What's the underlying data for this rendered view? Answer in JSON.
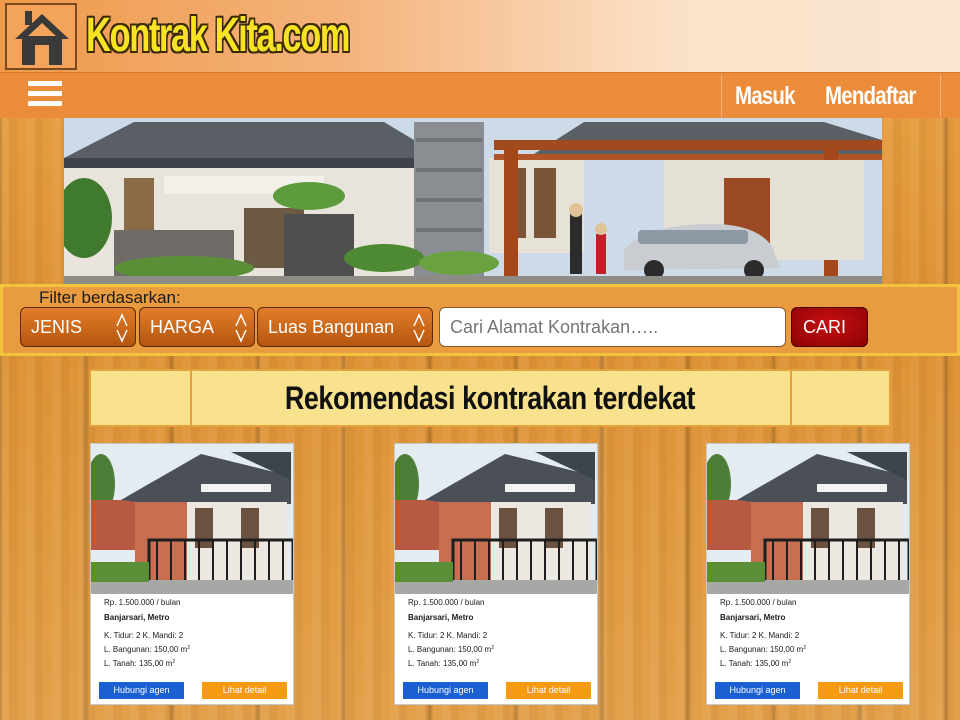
{
  "header": {
    "site_name": "Kontrak Kita.com"
  },
  "nav": {
    "login": "Masuk",
    "register": "Mendaftar"
  },
  "filter": {
    "title": "Filter berdasarkan:",
    "selects": [
      {
        "label": "JENIS"
      },
      {
        "label": "HARGA"
      },
      {
        "label": "Luas Bangunan"
      }
    ],
    "search_placeholder": "Cari Alamat Kontrakan…..",
    "search_button": "CARI"
  },
  "section": {
    "title": "Rekomendasi kontrakan terdekat"
  },
  "cards": [
    {
      "price": "Rp. 1.500.000  /  bulan",
      "location": "Banjarsari, Metro",
      "rooms": "K. Tidur: 2   K. Mandi: 2",
      "bangunan": "L. Bangunan: 150,00 m",
      "tanah": "L. Tanah: 135,00 m",
      "unit_sup": "2",
      "contact_button": "Hubungi agen",
      "detail_button": "Lihat detail"
    },
    {
      "price": "Rp. 1.500.000  /  bulan",
      "location": "Banjarsari, Metro",
      "rooms": "K. Tidur: 2   K. Mandi: 2",
      "bangunan": "L. Bangunan: 150,00 m",
      "tanah": "L. Tanah: 135,00 m",
      "unit_sup": "2",
      "contact_button": "Hubungi agen",
      "detail_button": "Lihat detail"
    },
    {
      "price": "Rp. 1.500.000  /  bulan",
      "location": "Banjarsari, Metro",
      "rooms": "K. Tidur: 2   K. Mandi: 2",
      "bangunan": "L. Bangunan: 150,00 m",
      "tanah": "L. Tanah: 135,00 m",
      "unit_sup": "2",
      "contact_button": "Hubungi agen",
      "detail_button": "Lihat detail"
    }
  ],
  "icons": {
    "logo": "house-icon",
    "menu": "hamburger-menu-icon",
    "select_arrows": "updown-arrows-icon"
  },
  "colors": {
    "header_orange": "#eb8c3b",
    "logo_yellow": "#f7e323",
    "section_bg": "#f8e28d",
    "search_button": "#b30a0c",
    "contact_button": "#1c5fd2",
    "detail_button": "#f69a12"
  }
}
